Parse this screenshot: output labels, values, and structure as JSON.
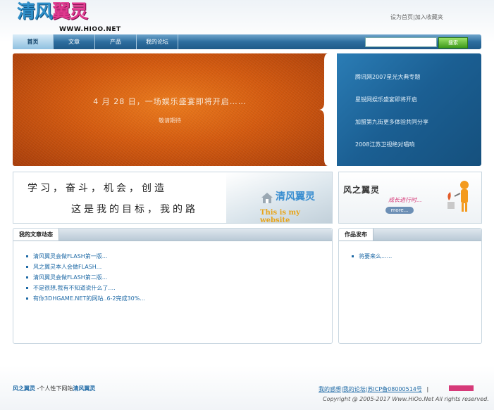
{
  "header": {
    "logo_cn_part1": "清风",
    "logo_cn_part2": "翼灵",
    "logo_url": "WWW.HIOO.NET",
    "top_links": {
      "set_home": "设为首页",
      "sep": "|",
      "add_fav": "加入收藏夹"
    }
  },
  "nav": {
    "items": [
      {
        "label": "首页"
      },
      {
        "label": "文章"
      },
      {
        "label": "产品"
      },
      {
        "label": "我的论坛"
      }
    ],
    "search_value": "",
    "search_button": "搜索"
  },
  "banner": {
    "title": "4 月 28 日，一场娱乐盛宴即将开启……",
    "subtitle": "敬请期待",
    "list": [
      "腾讯网2007星光大典专题",
      "星锐网娱乐盛宴即将开启",
      "加盟第九街更多体验共同分享",
      "2008江苏卫视绝对唱响"
    ]
  },
  "ad_left": {
    "line1": "学习，奋斗，机会，创造",
    "line2": "这是我的目标，我的路",
    "brand": "清风翼灵",
    "slogan": "This is my website"
  },
  "ad_right": {
    "title": "风之翼灵",
    "status": "成长进行时...",
    "more": "more..."
  },
  "articles": {
    "title": "我的文章动态",
    "items": [
      "清风翼灵会做FLASH第一版...",
      "风之翼灵本人会做FLASH...",
      "清风翼灵会做FLASH第二版...",
      "不是很想,我有不知道说什么了....",
      "有你3DHGAME.NET的网站..6-2完成30%..."
    ]
  },
  "works": {
    "title": "作品发布",
    "items": [
      "将要来么......"
    ]
  },
  "footer": {
    "brand": "风之翼灵",
    "tagline": "-个人性下网站",
    "brand2": "清风翼灵",
    "links": "我的感想|我的论坛|苏ICP备08000514号",
    "link_sep": "|",
    "copyright": "Copyright @ 2005-2017 Www.HiOo.Net All rights reserved."
  }
}
